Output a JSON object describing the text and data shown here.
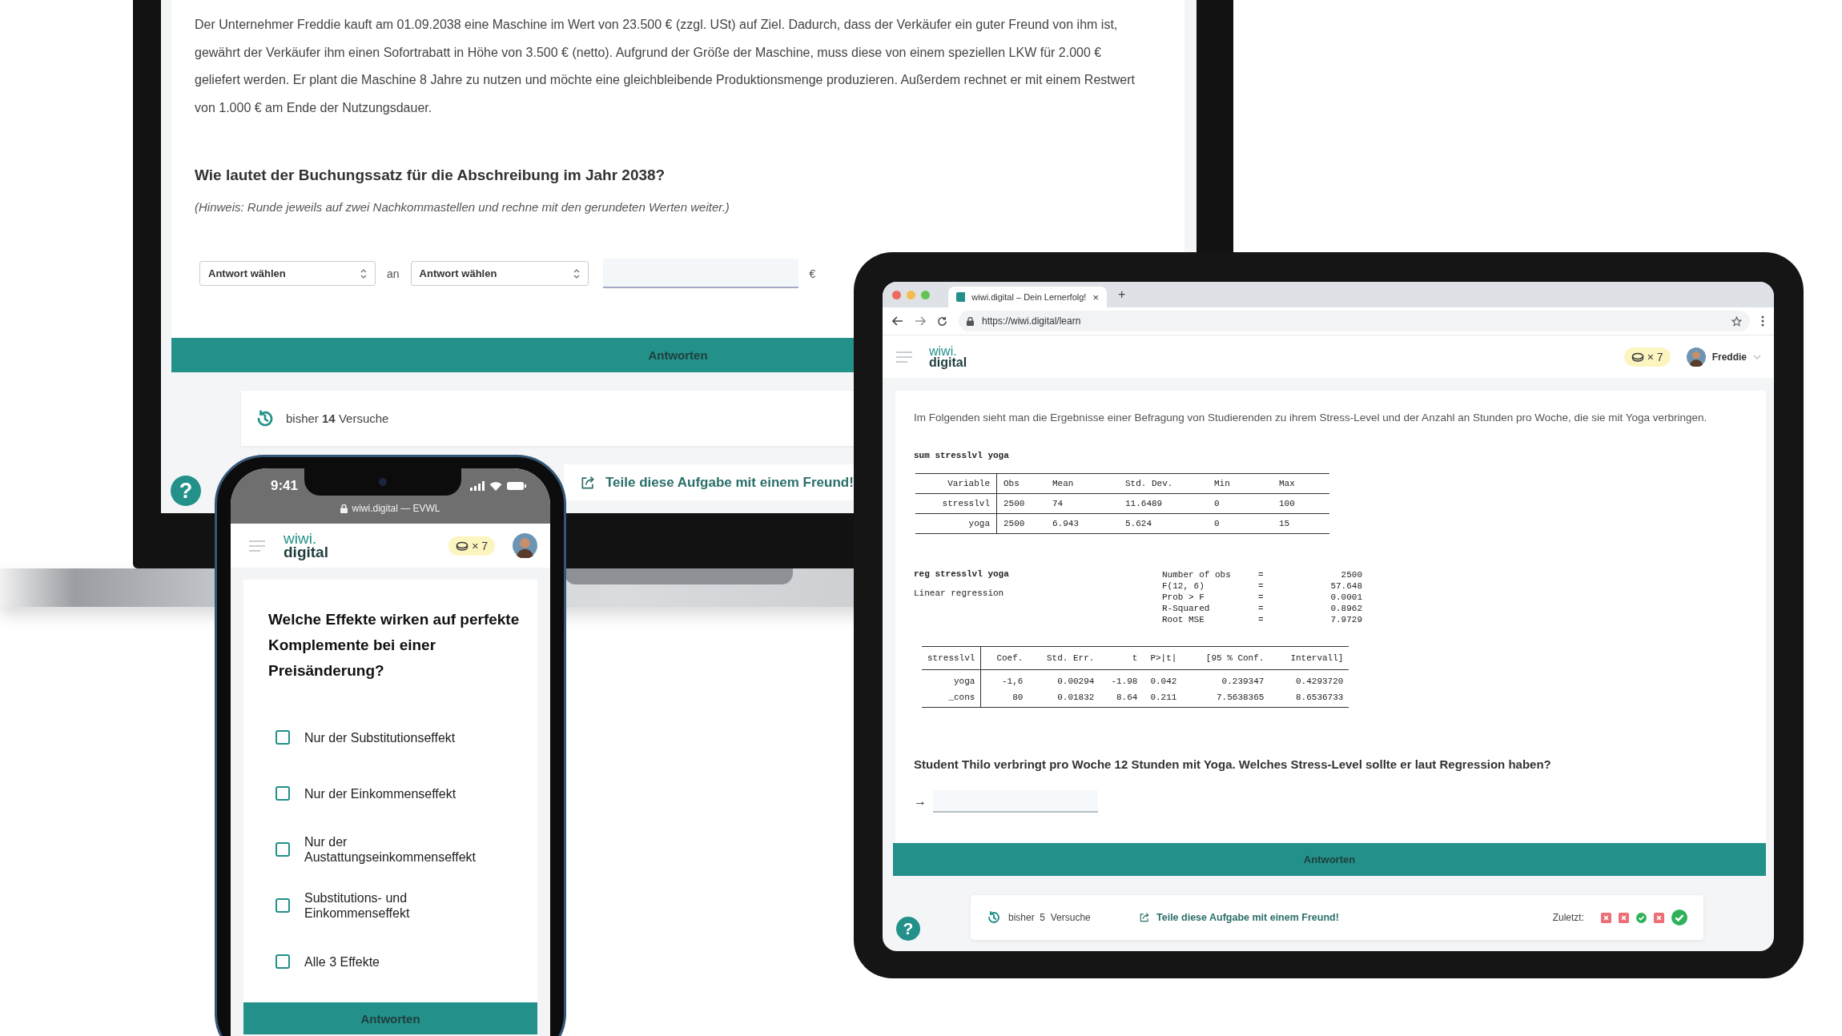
{
  "laptop": {
    "paragraph": "Der Unternehmer Freddie kauft am 01.09.2038 eine Maschine im Wert von 23.500 € (zzgl. USt) auf Ziel. Dadurch, dass der Verkäufer ein guter Freund von ihm ist, gewährt der Verkäufer ihm einen Sofortrabatt in Höhe von 3.500 € (netto). Aufgrund der Größe der Maschine, muss diese von einem speziellen LKW für 2.000 € geliefert werden. Er plant die Maschine 8 Jahre zu nutzen und möchte eine gleichbleibende Produktionsmenge produzieren. Außerdem rechnet er mit einem Restwert von 1.000 € am Ende der Nutzungsdauer.",
    "question": "Wie lautet der Buchungssatz für die Abschreibung im Jahr 2038?",
    "hint": "(Hinweis: Runde jeweils auf zwei Nachkommastellen und rechne mit den gerundeten Werten weiter.)",
    "selects": [
      {
        "value": "Antwort wählen"
      },
      {
        "value": "Antwort wählen"
      }
    ],
    "connector": "an",
    "currency": "€",
    "submit": "Antworten",
    "attempts": "bisher **14** Versuche",
    "share": "Teile diese Aufgabe mit einem Freund!",
    "help": "?"
  },
  "phone": {
    "time": "9:41",
    "url": "wiwi.digital — EVWL",
    "logo": {
      "top": "wiwi.",
      "bottom": "digital"
    },
    "coins": "× 7",
    "question": "Welche Effekte wirken auf perfekte Komplemente bei einer Preisänderung?",
    "options": [
      {
        "label": "Nur der Substitutionseffekt",
        "checked": false
      },
      {
        "label": "Nur der Einkommenseffekt",
        "checked": false
      },
      {
        "label": "Nur der Austattungseinkommenseffekt",
        "checked": false
      },
      {
        "label": "Substitutions- und Einkommenseffekt",
        "checked": false
      },
      {
        "label": "Alle 3 Effekte",
        "checked": false
      }
    ],
    "submit": "Antworten"
  },
  "tablet": {
    "tab_title": "wiwi.digital – Dein Lernerfolg!",
    "tab_close": "×",
    "new_tab": "+",
    "url": "https://wiwi.digital/learn",
    "logo": {
      "top": "wiwi.",
      "bottom": "digital"
    },
    "coins": "× 7",
    "user": "Freddie",
    "intro": "Im Folgenden sieht man die Ergebnisse einer Befragung von Studierenden zu ihrem Stress-Level und der Anzahl an Stunden pro Woche, die sie mit Yoga verbringen.",
    "summary": {
      "command": "sum stresslvl yoga",
      "columns": [
        "Variable",
        "Obs",
        "Mean",
        "Std. Dev.",
        "Min",
        "Max"
      ],
      "rows": [
        {
          "cells": [
            "stresslvl",
            "2500",
            "74",
            "11.6489",
            "0",
            "100"
          ]
        },
        {
          "cells": [
            "yoga",
            "2500",
            "6.943",
            "5.624",
            "0",
            "15"
          ]
        }
      ]
    },
    "regression": {
      "command": "reg stresslvl yoga",
      "label": "Linear regression",
      "stats": [
        {
          "name": "Number of obs",
          "eq": "=",
          "value": "2500"
        },
        {
          "name": "F(12, 6)",
          "eq": "=",
          "value": "57.648"
        },
        {
          "name": "Prob > F",
          "eq": "=",
          "value": "0.0001"
        },
        {
          "name": "R-Squared",
          "eq": "=",
          "value": "0.8962"
        },
        {
          "name": "Root MSE",
          "eq": "=",
          "value": "7.9729"
        }
      ],
      "columns": [
        "stresslvl",
        "Coef.",
        "Std. Err.",
        "t",
        "P>|t|",
        "[95 % Conf.",
        "Intervall]"
      ],
      "rows": [
        {
          "cells": [
            "yoga",
            "-1,6",
            "0.00294",
            "-1.98",
            "0.042",
            "0.239347",
            "0.4293720"
          ]
        },
        {
          "cells": [
            "_cons",
            "80",
            "0.01832",
            "8.64",
            "0.211",
            "7.5638365",
            "8.6536733"
          ]
        }
      ]
    },
    "question": "Student Thilo verbringt pro Woche 12 Stunden mit Yoga. Welches Stress-Level sollte er laut Regression haben?",
    "arrow": "→",
    "submit": "Antworten",
    "attempts": "bisher  5  Versuche",
    "share": "Teile diese Aufgabe mit einem Freund!",
    "recent_label": "Zuletzt:",
    "recent": [
      {
        "kind": "wrong",
        "latest": false
      },
      {
        "kind": "wrong",
        "latest": false
      },
      {
        "kind": "correct",
        "latest": false
      },
      {
        "kind": "wrong",
        "latest": false
      },
      {
        "kind": "correct",
        "latest": true
      }
    ],
    "help": "?"
  }
}
